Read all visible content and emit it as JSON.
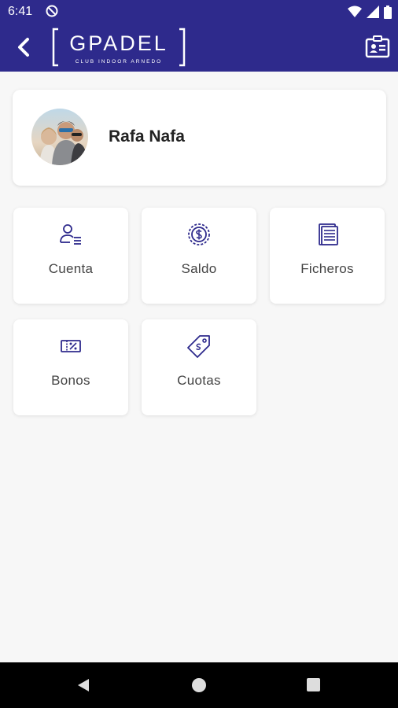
{
  "status_bar": {
    "time": "6:41"
  },
  "header": {
    "logo_text": "GPADEL",
    "logo_subtitle": "CLUB INDOOR ARNEDO",
    "accent_color": "#2e2a8c"
  },
  "profile": {
    "name": "Rafa Nafa"
  },
  "tiles": [
    {
      "label": "Cuenta",
      "icon": "user-list-icon"
    },
    {
      "label": "Saldo",
      "icon": "coin-icon"
    },
    {
      "label": "Ficheros",
      "icon": "document-icon"
    },
    {
      "label": "Bonos",
      "icon": "voucher-icon"
    },
    {
      "label": "Cuotas",
      "icon": "price-tag-icon"
    }
  ]
}
